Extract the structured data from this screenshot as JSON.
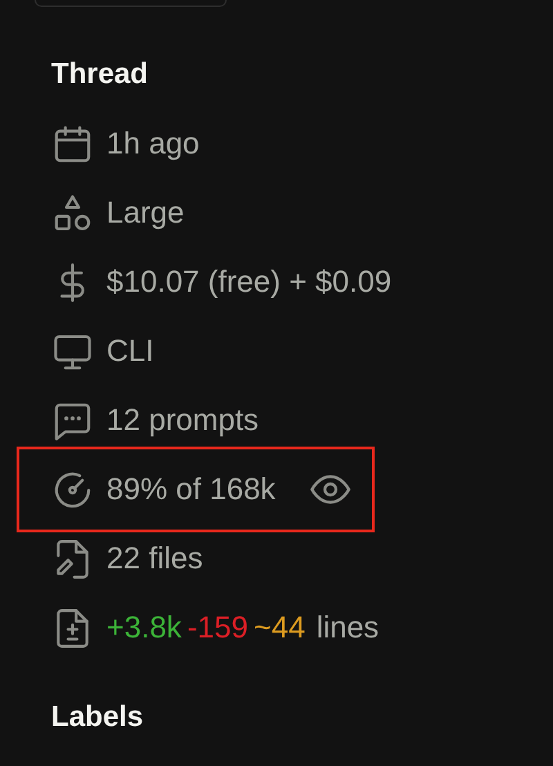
{
  "sections": [
    {
      "title": "Thread",
      "items": [
        {
          "kind": "time",
          "text": "1h ago",
          "highlighted": false
        },
        {
          "kind": "size",
          "text": "Large",
          "highlighted": false
        },
        {
          "kind": "cost",
          "text": "$10.07 (free) + $0.09",
          "highlighted": false
        },
        {
          "kind": "client",
          "text": "CLI",
          "highlighted": false
        },
        {
          "kind": "prompts",
          "text": "12 prompts",
          "highlighted": false
        },
        {
          "kind": "context",
          "text": "89% of 168k",
          "highlighted": true
        },
        {
          "kind": "files",
          "text": "22 files",
          "highlighted": false
        },
        {
          "kind": "lines",
          "parts": [
            {
              "kind": "added",
              "text": "+3.8k"
            },
            {
              "kind": "removed",
              "text": "-159"
            },
            {
              "kind": "changed",
              "text": "~44"
            },
            {
              "kind": "plain",
              "text": "lines"
            }
          ],
          "highlighted": false
        }
      ]
    },
    {
      "title": "Labels"
    }
  ]
}
